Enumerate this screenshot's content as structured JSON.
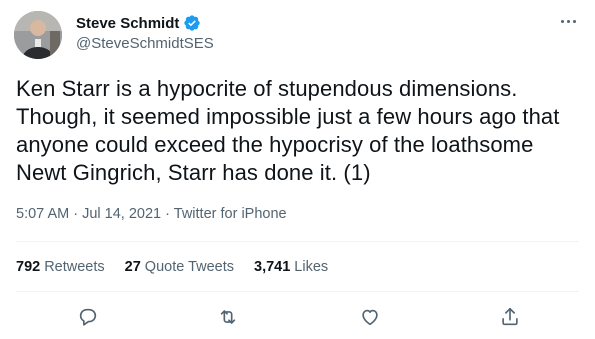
{
  "author": {
    "display_name": "Steve Schmidt",
    "handle": "@SteveSchmidtSES",
    "verified": true,
    "avatar_icon": "profile-photo"
  },
  "tweet": {
    "text": "Ken Starr is a hypocrite of stupendous dimensions. Though, it seemed impossible just a few hours ago that anyone could exceed the hypocrisy of the loathsome Newt Gingrich, Starr has done it. (1)",
    "time": "5:07 AM",
    "separator": "·",
    "date": "Jul 14, 2021",
    "source": "Twitter for iPhone"
  },
  "stats": {
    "retweets": {
      "count": "792",
      "label": "Retweets"
    },
    "quote_tweets": {
      "count": "27",
      "label": "Quote Tweets"
    },
    "likes": {
      "count": "3,741",
      "label": "Likes"
    }
  },
  "actions": [
    {
      "name": "reply",
      "icon": "reply-icon"
    },
    {
      "name": "retweet",
      "icon": "retweet-icon"
    },
    {
      "name": "like",
      "icon": "heart-icon"
    },
    {
      "name": "share",
      "icon": "share-icon"
    }
  ],
  "colors": {
    "text_primary": "#0f1419",
    "text_secondary": "#536471",
    "verified_blue": "#1d9bf0",
    "divider": "#eff3f4"
  }
}
